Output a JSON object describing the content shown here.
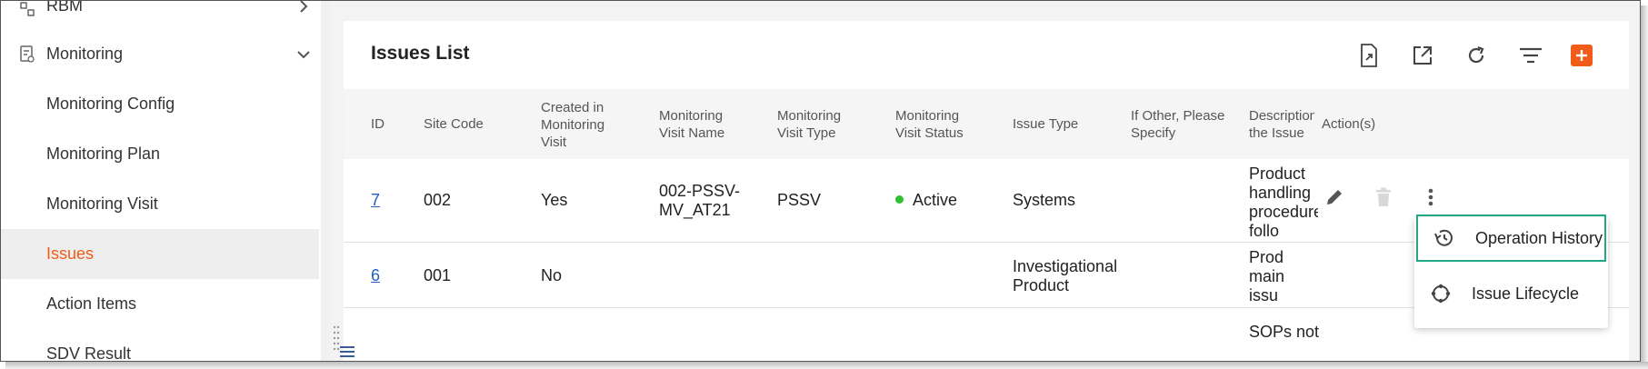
{
  "sidebar": {
    "items": [
      {
        "label": "RBM"
      },
      {
        "label": "Monitoring"
      },
      {
        "label": "Monitoring Config"
      },
      {
        "label": "Monitoring Plan"
      },
      {
        "label": "Monitoring Visit"
      },
      {
        "label": "Issues"
      },
      {
        "label": "Action Items"
      },
      {
        "label": "SDV Result"
      }
    ]
  },
  "main": {
    "title": "Issues List",
    "toolbar": {
      "icons": [
        "export-icon",
        "open-external-icon",
        "refresh-icon",
        "filter-icon",
        "add-icon"
      ],
      "add_label": "+"
    },
    "columns": [
      "ID",
      "Site Code",
      "Created in Monitoring Visit",
      "Monitoring Visit Name",
      "Monitoring Visit Type",
      "Monitoring Visit Status",
      "Issue Type",
      "If Other, Please Specify",
      "Description the Issue",
      "Action(s)"
    ],
    "rows": [
      {
        "id": "7",
        "site_code": "002",
        "created_in_visit": "Yes",
        "visit_name": "002-PSSV-MV_AT21",
        "visit_type": "PSSV",
        "visit_status": "Active",
        "issue_type": "Systems",
        "if_other": "",
        "description": "Product handling procedure follo"
      },
      {
        "id": "6",
        "site_code": "001",
        "created_in_visit": "No",
        "visit_name": "",
        "visit_type": "",
        "visit_status": "",
        "issue_type": "Investigational Product",
        "if_other": "",
        "description": "Prod main issu"
      },
      {
        "id": "",
        "site_code": "",
        "created_in_visit": "",
        "visit_name": "",
        "visit_type": "",
        "visit_status": "",
        "issue_type": "",
        "if_other": "",
        "description": "SOPs not"
      }
    ]
  },
  "menu": {
    "items": [
      {
        "label": "Operation History",
        "icon": "history-icon"
      },
      {
        "label": "Issue Lifecycle",
        "icon": "lifecycle-icon"
      }
    ]
  },
  "colors": {
    "accent": "#f25c1b",
    "highlight": "#22a887",
    "link": "#1f5fbf",
    "status_active": "#2fbf2f"
  }
}
